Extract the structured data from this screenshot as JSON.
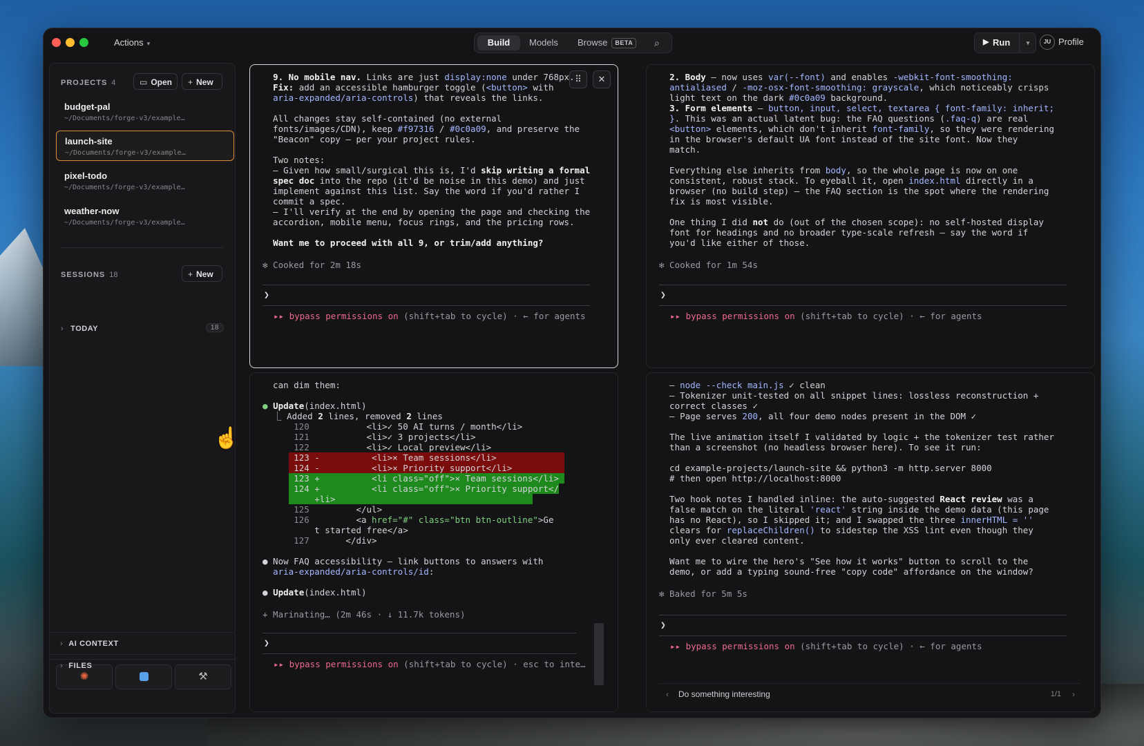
{
  "titlebar": {
    "actions_label": "Actions",
    "tabs": [
      "Build",
      "Models",
      "Browse"
    ],
    "beta_badge": "BETA",
    "run_label": "Run",
    "avatar_initials": "JU",
    "profile_label": "Profile"
  },
  "sidebar": {
    "projects_label": "PROJECTS",
    "projects_count": "4",
    "open_label": "Open",
    "new_label": "New",
    "projects": [
      {
        "name": "budget-pal",
        "path": "~/Documents/forge-v3/example…"
      },
      {
        "name": "launch-site",
        "path": "~/Documents/forge-v3/example…"
      },
      {
        "name": "pixel-todo",
        "path": "~/Documents/forge-v3/example…"
      },
      {
        "name": "weather-now",
        "path": "~/Documents/forge-v3/example…"
      }
    ],
    "sessions_label": "SESSIONS",
    "sessions_count": "18",
    "sessions_new_label": "New",
    "today_label": "TODAY",
    "today_count": "18",
    "ai_context_label": "AI CONTEXT",
    "files_label": "FILES"
  },
  "status": {
    "bypass": "▸▸ bypass permissions on",
    "bypass_hint": " (shift+tab to cycle) · ← for agents",
    "bypass_hint_interrupt": " (shift+tab to cycle) · esc to inte…"
  },
  "pane_tl": {
    "cooked": "✻ Cooked for 2m 18s"
  },
  "pane_tr": {
    "cooked": "✻ Cooked for 1m 54s"
  },
  "pane_bl": {
    "marinating": "+ Marinating… (2m 46s · ↓ 11.7k tokens)"
  },
  "pane_br": {
    "baked": "✻ Baked for 5m 5s",
    "history_text": "Do something interesting",
    "history_count": "1/1"
  }
}
